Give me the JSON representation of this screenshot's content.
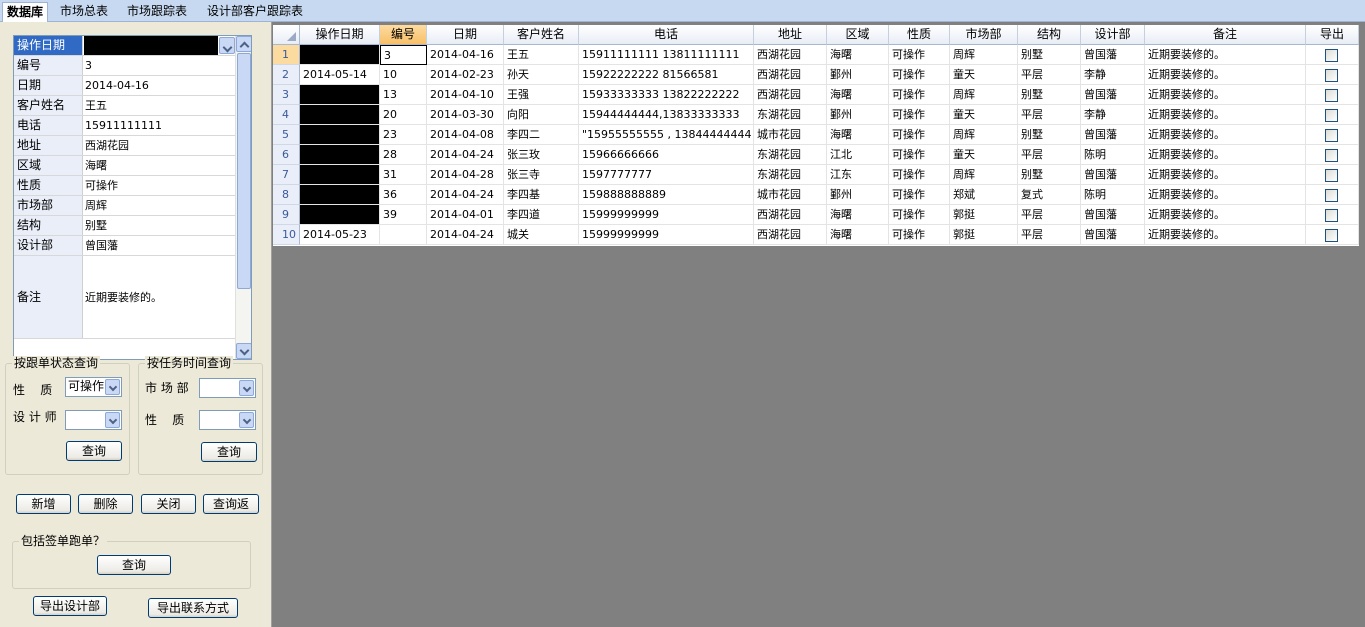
{
  "tabs": [
    "数据库",
    "市场总表",
    "市场跟踪表",
    "设计部客户跟踪表"
  ],
  "detail": {
    "fields": [
      {
        "label": "操作日期",
        "value": ""
      },
      {
        "label": "编号",
        "value": "3"
      },
      {
        "label": "日期",
        "value": "2014-04-16"
      },
      {
        "label": "客户姓名",
        "value": "王五"
      },
      {
        "label": "电话",
        "value": "15911111111"
      },
      {
        "label": "地址",
        "value": "西湖花园"
      },
      {
        "label": "区域",
        "value": "海曙"
      },
      {
        "label": "性质",
        "value": "可操作"
      },
      {
        "label": "市场部",
        "value": "周辉"
      },
      {
        "label": "结构",
        "value": "别墅"
      },
      {
        "label": "设计部",
        "value": "曾国藩"
      },
      {
        "label": "备注",
        "value": "近期要装修的。"
      }
    ]
  },
  "status_query": {
    "title": "按跟单状态查询",
    "nature_label": "性    质",
    "nature_value": "可操作",
    "designer_label": "设 计 师",
    "designer_value": "",
    "button": "查询"
  },
  "time_query": {
    "title": "按任务时间查询",
    "market_label": "市 场 部",
    "market_value": "",
    "nature_label": "性    质",
    "nature_value": "",
    "button": "查询"
  },
  "actions": {
    "add": "新增",
    "delete": "删除",
    "close": "关闭",
    "query_back": "查询返"
  },
  "signed": {
    "title": "包括签单跑单？",
    "button": "查询"
  },
  "export": {
    "design": "导出设计部",
    "contact": "导出联系方式"
  },
  "grid": {
    "columns": [
      "操作日期",
      "编号",
      "日期",
      "客户姓名",
      "电话",
      "地址",
      "区域",
      "性质",
      "市场部",
      "结构",
      "设计部",
      "备注",
      "导出"
    ],
    "rows": [
      {
        "num": "1",
        "cells": [
          "",
          "3",
          "2014-04-16",
          "王五",
          "15911111111    13811111111",
          "西湖花园",
          "海曙",
          "可操作",
          "周辉",
          "别墅",
          "曾国藩",
          "近期要装修的。"
        ]
      },
      {
        "num": "2",
        "cells": [
          "2014-05-14",
          "10",
          "2014-02-23",
          "孙天",
          "15922222222  81566581",
          "西湖花园",
          "鄞州",
          "可操作",
          "童天",
          "平层",
          "李静",
          "近期要装修的。"
        ]
      },
      {
        "num": "3",
        "cells": [
          "",
          "13",
          "2014-04-10",
          "王强",
          "15933333333  13822222222",
          "西湖花园",
          "海曙",
          "可操作",
          "周辉",
          "别墅",
          "曾国藩",
          "近期要装修的。"
        ]
      },
      {
        "num": "4",
        "cells": [
          "",
          "20",
          "2014-03-30",
          "向阳",
          "15944444444,13833333333",
          "东湖花园",
          "鄞州",
          "可操作",
          "童天",
          "平层",
          "李静",
          "近期要装修的。"
        ]
      },
      {
        "num": "5",
        "cells": [
          "",
          "23",
          "2014-04-08",
          "李四二",
          "\"15955555555   , 13844444444",
          "城市花园",
          "海曙",
          "可操作",
          "周辉",
          "别墅",
          "曾国藩",
          "近期要装修的。"
        ]
      },
      {
        "num": "6",
        "cells": [
          "",
          "28",
          "2014-04-24",
          "张三玫",
          "15966666666",
          "东湖花园",
          "江北",
          "可操作",
          "童天",
          "平层",
          "陈明",
          "近期要装修的。"
        ]
      },
      {
        "num": "7",
        "cells": [
          "",
          "31",
          "2014-04-28",
          "张三寺",
          "1597777777",
          "东湖花园",
          "江东",
          "可操作",
          "周辉",
          "别墅",
          "曾国藩",
          "近期要装修的。"
        ]
      },
      {
        "num": "8",
        "cells": [
          "",
          "36",
          "2014-04-24",
          "李四基",
          "159888888889",
          "城市花园",
          "鄞州",
          "可操作",
          "郑斌",
          "复式",
          "陈明",
          "近期要装修的。"
        ]
      },
      {
        "num": "9",
        "cells": [
          "",
          "39",
          "2014-04-01",
          "李四道",
          "15999999999",
          "西湖花园",
          "海曙",
          "可操作",
          "郭挺",
          "平层",
          "曾国藩",
          "近期要装修的。"
        ]
      },
      {
        "num": "10",
        "cells": [
          "2014-05-23",
          "",
          "2014-04-24",
          "城关",
          "15999999999",
          "西湖花园",
          "海曙",
          "可操作",
          "郭挺",
          "平层",
          "曾国藩",
          "近期要装修的。"
        ]
      }
    ],
    "redacted_rows": [
      "1",
      "3",
      "4",
      "5",
      "6",
      "7",
      "8",
      "9"
    ]
  }
}
